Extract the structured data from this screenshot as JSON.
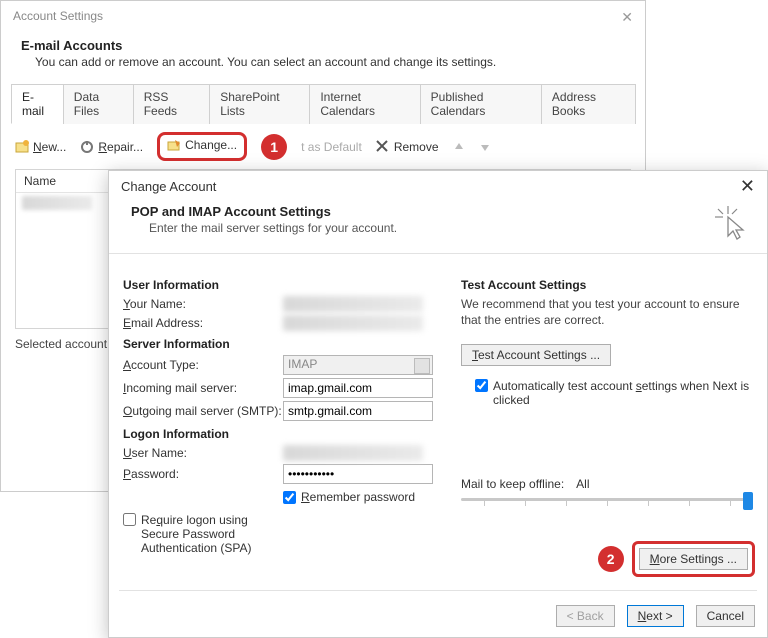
{
  "settings": {
    "title": "Account Settings",
    "heading": "E-mail Accounts",
    "sub": "You can add or remove an account. You can select an account and change its settings.",
    "tabs": [
      "E-mail",
      "Data Files",
      "RSS Feeds",
      "SharePoint Lists",
      "Internet Calendars",
      "Published Calendars",
      "Address Books"
    ],
    "toolbar": {
      "new": "New...",
      "repair": "Repair...",
      "change": "Change...",
      "default": "t as Default",
      "remove": "Remove"
    },
    "list_header": "Name",
    "selected_desc": "Selected account de"
  },
  "change": {
    "title": "Change Account",
    "header": "POP and IMAP Account Settings",
    "sub": "Enter the mail server settings for your account.",
    "sections": {
      "user_info": "User Information",
      "server_info": "Server Information",
      "logon_info": "Logon Information"
    },
    "labels": {
      "your_name": "Your Name:",
      "email": "Email Address:",
      "acct_type": "Account Type:",
      "incoming": "Incoming mail server:",
      "outgoing": "Outgoing mail server (SMTP):",
      "user_name": "User Name:",
      "password": "Password:",
      "remember": "Remember password",
      "spa": "Require logon using Secure Password Authentication (SPA)"
    },
    "values": {
      "acct_type": "IMAP",
      "incoming": "imap.gmail.com",
      "outgoing": "smtp.gmail.com",
      "password": "***********"
    },
    "test": {
      "heading": "Test Account Settings",
      "desc": "We recommend that you test your account to ensure that the entries are correct.",
      "button": "Test Account Settings ...",
      "auto": "Automatically test account settings when Next is clicked"
    },
    "mail_offline": {
      "label": "Mail to keep offline:",
      "value": "All"
    },
    "more_settings": "More Settings ...",
    "buttons": {
      "back": "< Back",
      "next": "Next >",
      "cancel": "Cancel"
    }
  },
  "annotations": {
    "one": "1",
    "two": "2"
  }
}
